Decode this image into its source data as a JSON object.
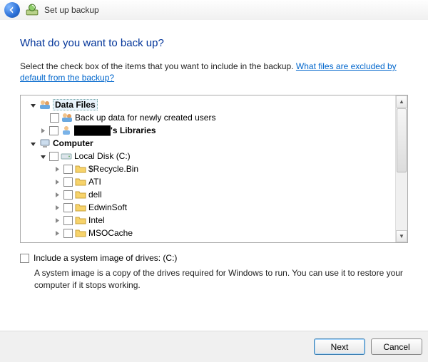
{
  "window": {
    "title": "Set up backup"
  },
  "heading": "What do you want to back up?",
  "intro_text": "Select the check box of the items that you want to include in the backup. ",
  "intro_link": "What files are excluded by default from the backup?",
  "tree": {
    "data_files": "Data Files",
    "new_users": "Back up data for newly created users",
    "user_libraries": "██████'s Libraries",
    "computer": "Computer",
    "local_disk": "Local Disk (C:)",
    "folders": [
      "$Recycle.Bin",
      "ATI",
      "dell",
      "EdwinSoft",
      "Intel",
      "MSOCache"
    ]
  },
  "sysimg": {
    "label": "Include a system image of drives: (C:)",
    "desc": "A system image is a copy of the drives required for Windows to run. You can use it to restore your computer if it stops working."
  },
  "buttons": {
    "next": "Next",
    "cancel": "Cancel"
  }
}
